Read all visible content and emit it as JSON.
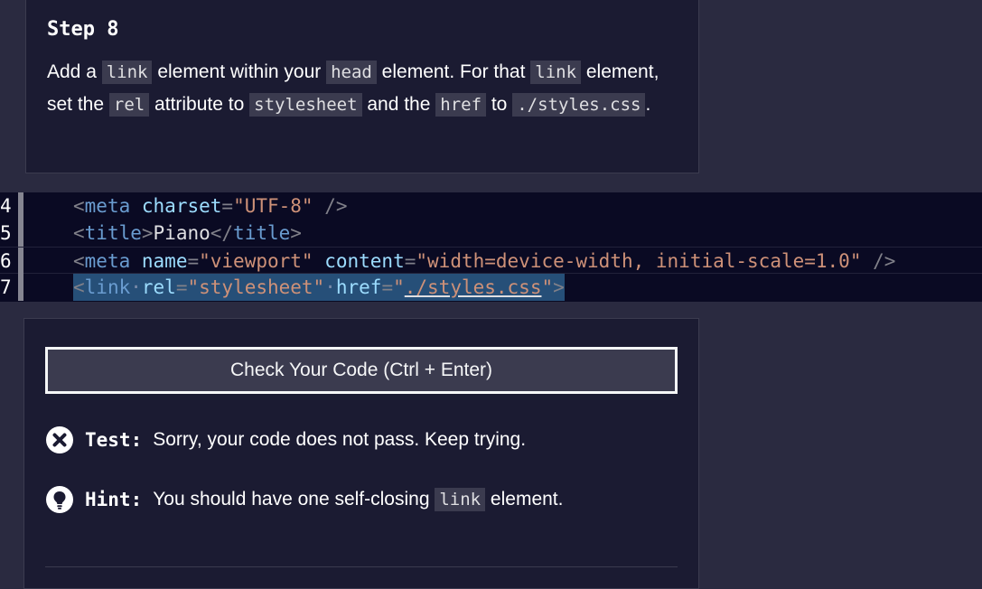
{
  "step": {
    "title": "Step 8",
    "desc": {
      "t1": "Add a ",
      "c1": "link",
      "t2": " element within your ",
      "c2": "head",
      "t3": " element. For that ",
      "c3": "link",
      "t4": " element, set the ",
      "c4": "rel",
      "t5": " attribute to ",
      "c5": "stylesheet",
      "t6": " and the ",
      "c6": "href",
      "t7": " to ",
      "c7": "./styles.css",
      "t8": "."
    }
  },
  "editor": {
    "lines": [
      {
        "num": "4",
        "tag_open": "<",
        "tag": "meta",
        "attr1": "charset",
        "eq1": "=",
        "val1": "\"UTF-8\"",
        "close": " />"
      },
      {
        "num": "5",
        "open": "<",
        "tag": "title",
        "gt": ">",
        "text": "Piano",
        "end_open": "</",
        "end_tag": "title",
        "end_gt": ">"
      },
      {
        "num": "6",
        "open": "<",
        "tag": "meta",
        "attr1": "name",
        "eq1": "=",
        "val1": "\"viewport\"",
        "attr2": "content",
        "eq2": "=",
        "val2": "\"width=device-width, initial-scale=1.0\"",
        "close": " />"
      },
      {
        "num": "7",
        "open": "<",
        "tag": "link",
        "attr1": "rel",
        "eq1": "=",
        "val1": "\"stylesheet\"",
        "attr2": "href",
        "eq2": "=",
        "q_open": "\"",
        "val2": "./styles.css",
        "q_close": "\"",
        "gt": ">"
      }
    ]
  },
  "tests": {
    "check_button": "Check Your Code (Ctrl + Enter)",
    "test_label": "Test:",
    "test_msg": "Sorry, your code does not pass. Keep trying.",
    "hint_label": "Hint:",
    "hint_msg_pre": "You should have one self-closing ",
    "hint_code": "link",
    "hint_msg_post": " element."
  },
  "icons": {
    "fail": "x-circle-icon",
    "hint": "lightbulb-icon"
  }
}
